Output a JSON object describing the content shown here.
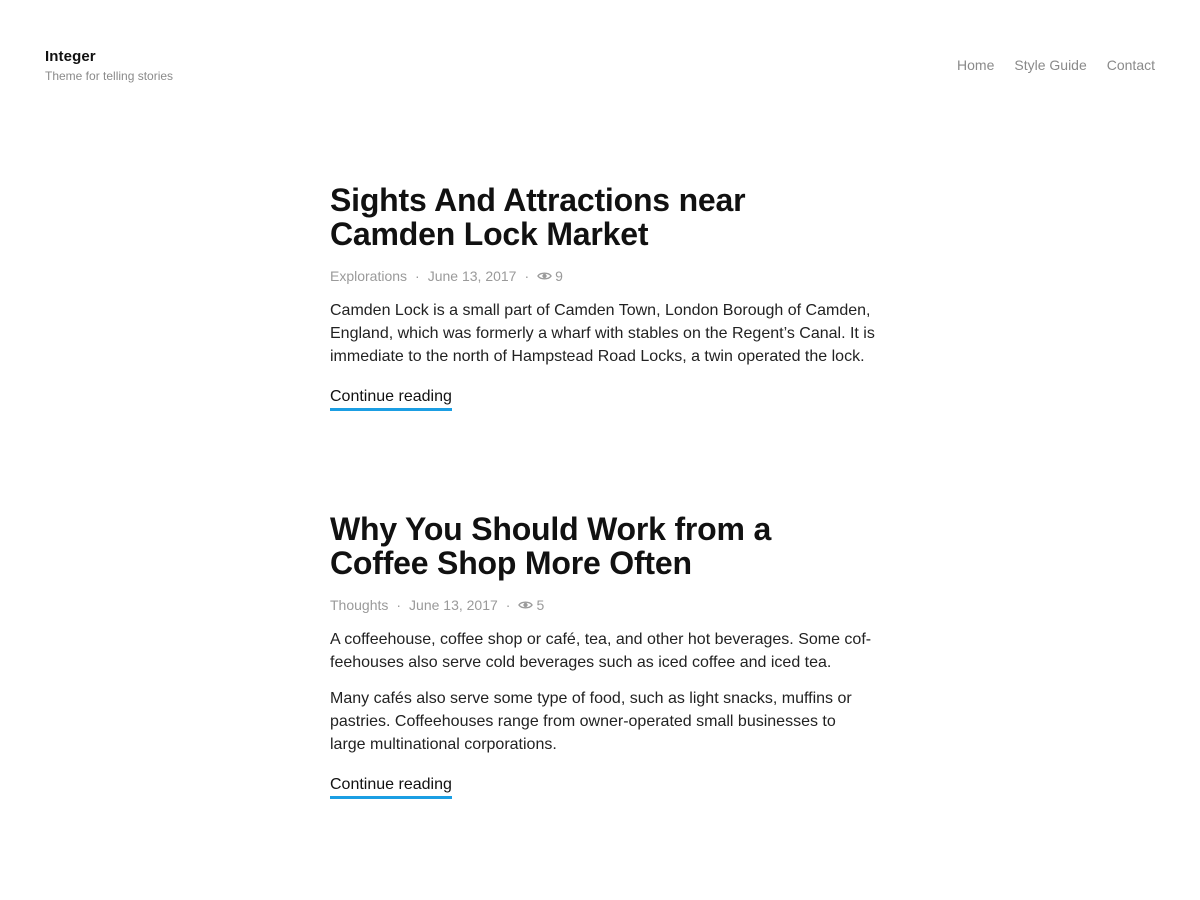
{
  "header": {
    "site_title": "Integer",
    "tagline": "Theme for telling stories",
    "nav": [
      "Home",
      "Style Guide",
      "Contact"
    ]
  },
  "posts": [
    {
      "title_line1": "Sights And Attractions near",
      "title_line2": "Camden Lock Market",
      "category": "Explorations",
      "date": "June 13, 2017",
      "views": "9",
      "paragraphs": [
        "Camden Lock is a small part of Camden Town, London Borough of Camden, England, which was formerly a wharf with stables on the Regent’s Canal. It is immediate to the north of Hampstead Road Locks, a twin operated the lock."
      ],
      "continue_label": "Continue reading"
    },
    {
      "title_line1": "Why You Should Work from a",
      "title_line2": "Coffee Shop More Often",
      "category": "Thoughts",
      "date": "June 13, 2017",
      "views": "5",
      "paragraphs": [
        "A coffeehouse, coffee shop or café, tea, and other hot beverages. Some cof­feehouses also serve cold beverages such as iced coffee and iced tea.",
        "Many cafés also serve some type of food, such as light snacks, muffins or pastries. Coffeehouses range from owner-operated small businesses to large multinational corporations."
      ],
      "continue_label": "Continue reading"
    }
  ],
  "icons": {
    "views": "eye-icon"
  },
  "colors": {
    "accent": "#1b9ee3",
    "text": "#111111",
    "muted": "#8a8a8a"
  }
}
